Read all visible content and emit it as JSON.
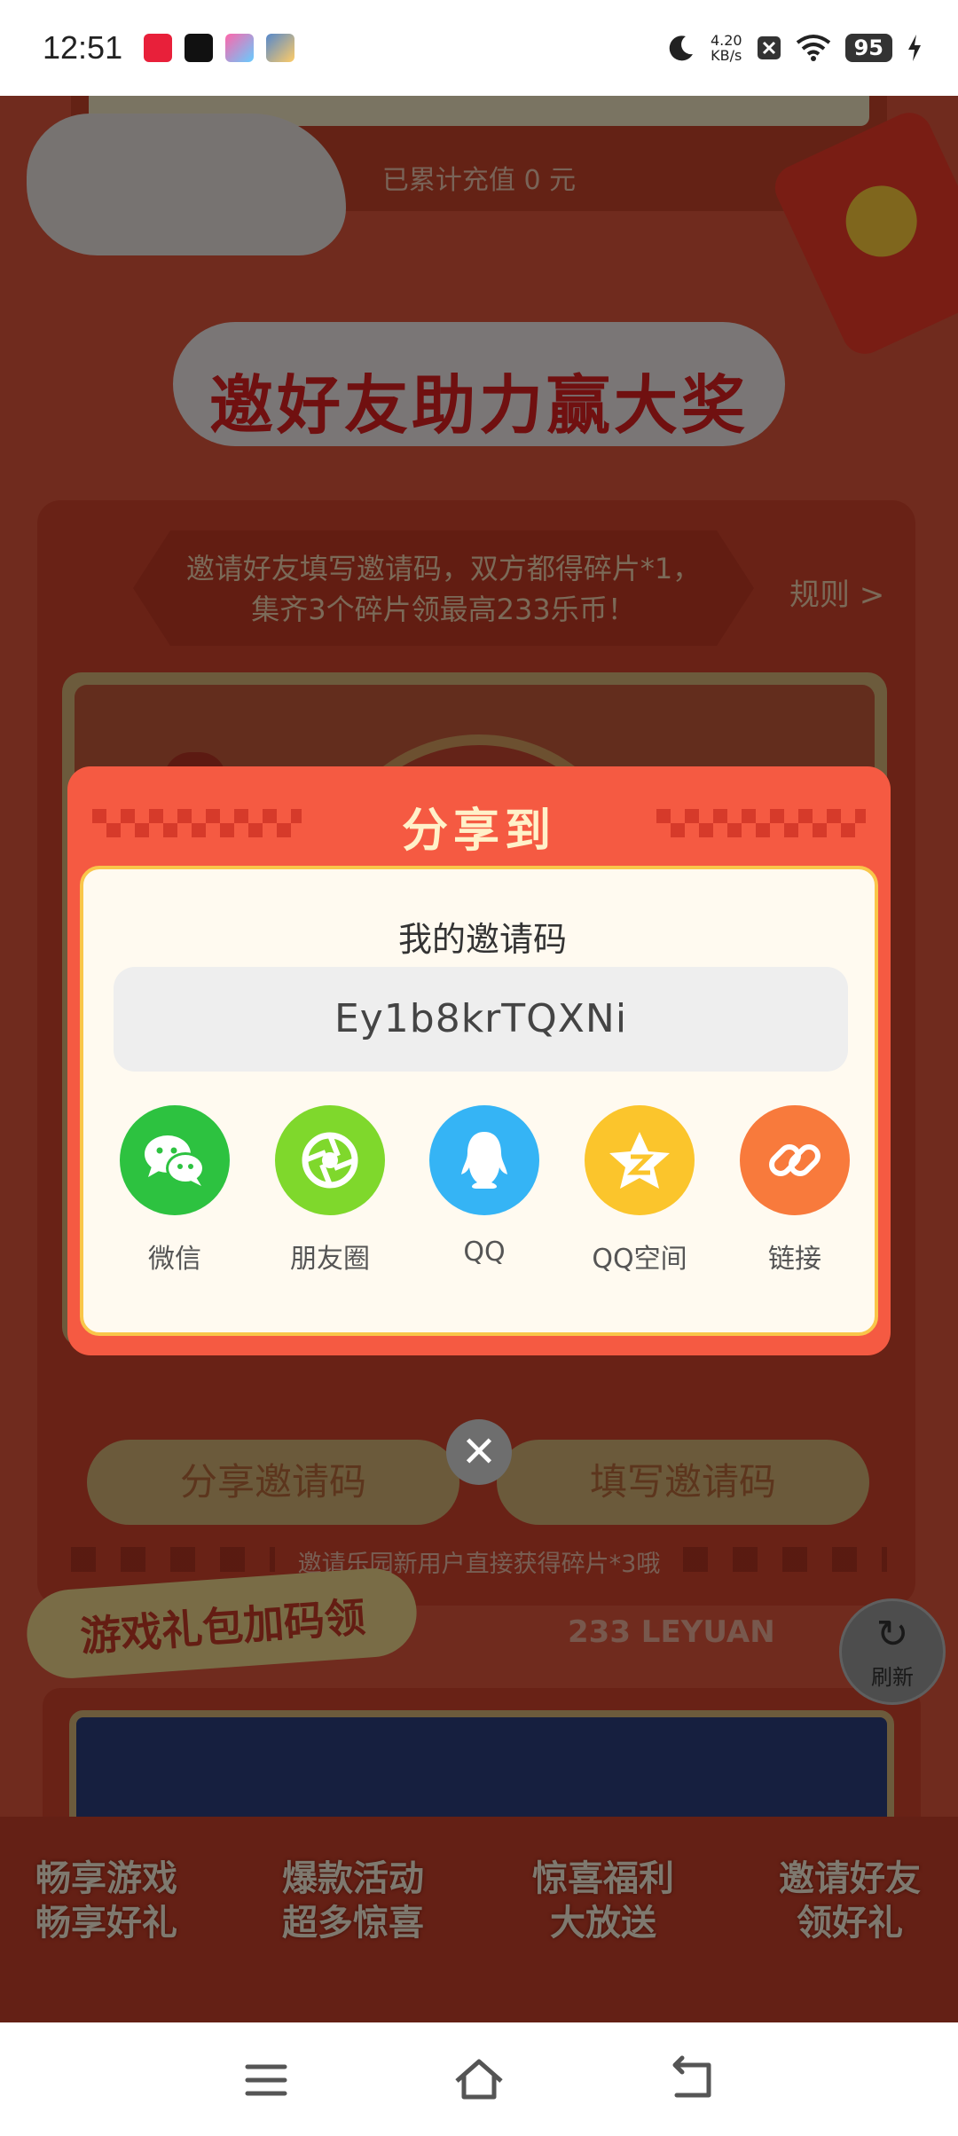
{
  "status_bar": {
    "time": "12:51",
    "net_speed_value": "4.20",
    "net_speed_unit": "KB/s",
    "battery": "95",
    "app_icons": [
      "app-icon-1",
      "tiktok-icon",
      "game-icon-1",
      "game-icon-2"
    ],
    "icons": [
      "moon-icon",
      "close-box-icon",
      "wifi-icon",
      "battery-icon",
      "charging-icon"
    ]
  },
  "background_page": {
    "recharge_text": "已累计充值 0 元",
    "section_title": "邀好友助力赢大奖",
    "invite_desc": "邀请好友填写邀请码，双方都得碎片*1，集齐3个碎片领最高233乐币！",
    "rules_link": "规则 >",
    "share_code_button": "分享邀请码",
    "fill_code_button": "填写邀请码",
    "hint_text": "邀请乐园新用户直接获得碎片*3哦",
    "gift_tag": "游戏礼包加码领",
    "leyuan_label": "233 LEYUAN",
    "features": [
      {
        "line1": "畅享游戏",
        "line2": "畅享好礼"
      },
      {
        "line1": "爆款活动",
        "line2": "超多惊喜"
      },
      {
        "line1": "惊喜福利",
        "line2": "大放送"
      },
      {
        "line1": "邀请好友",
        "line2": "领好礼"
      }
    ],
    "refresh_label": "刷新"
  },
  "dialog": {
    "title": "分享到",
    "my_code_label": "我的邀请码",
    "invite_code": "Ey1b8krTQXNi",
    "share_options": [
      {
        "label": "微信",
        "icon": "wechat-icon",
        "color": "#2dc240"
      },
      {
        "label": "朋友圈",
        "icon": "moments-icon",
        "color": "#7fd82c"
      },
      {
        "label": "QQ",
        "icon": "qq-icon",
        "color": "#35b4f5"
      },
      {
        "label": "QQ空间",
        "icon": "qzone-icon",
        "color": "#fbc52c"
      },
      {
        "label": "链接",
        "icon": "link-icon",
        "color": "#f87a3c"
      }
    ]
  },
  "colors": {
    "dialog_red": "#f55a42",
    "panel_bg": "#fffaf0",
    "title_cream": "#fff1c9"
  }
}
